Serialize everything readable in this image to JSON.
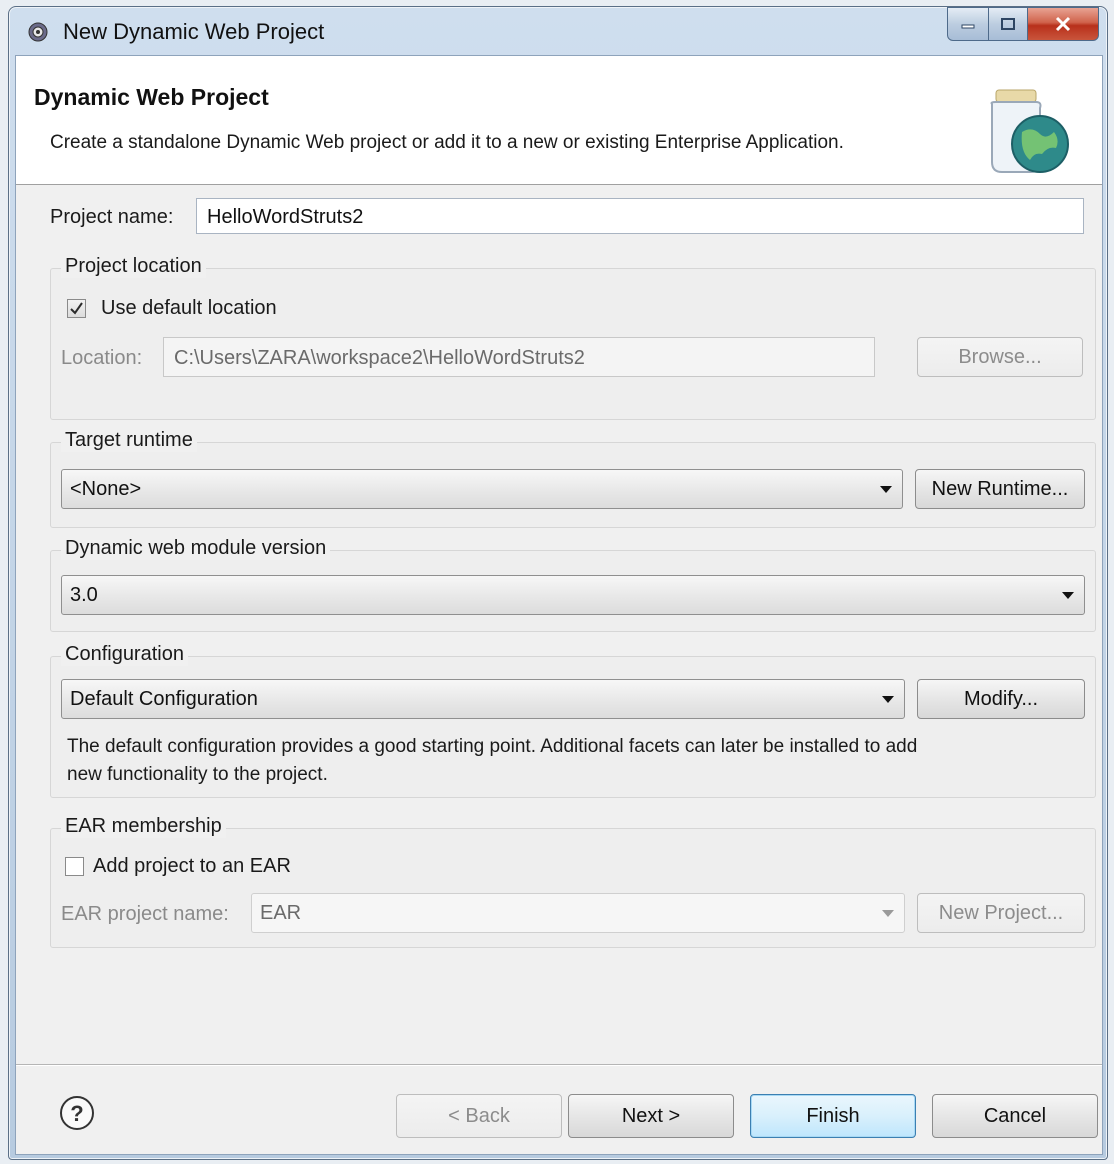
{
  "window": {
    "title": "New Dynamic Web Project"
  },
  "banner": {
    "title": "Dynamic Web Project",
    "description": "Create a standalone Dynamic Web project or add it to a new or existing Enterprise Application."
  },
  "project_name": {
    "label": "Project name:",
    "value": "HelloWordStruts2"
  },
  "project_location": {
    "group_title": "Project location",
    "use_default_label": "Use default location",
    "use_default_checked": true,
    "location_label": "Location:",
    "location_value": "C:\\Users\\ZARA\\workspace2\\HelloWordStruts2",
    "browse_label": "Browse..."
  },
  "target_runtime": {
    "group_title": "Target runtime",
    "selected": "<None>",
    "new_runtime_label": "New Runtime..."
  },
  "module_version": {
    "group_title": "Dynamic web module version",
    "selected": "3.0"
  },
  "configuration": {
    "group_title": "Configuration",
    "selected": "Default Configuration",
    "modify_label": "Modify...",
    "description_line1": "The default configuration provides a good starting point. Additional facets can later be installed to add",
    "description_line2": "new functionality to the project."
  },
  "ear": {
    "group_title": "EAR membership",
    "add_label": "Add project to an EAR",
    "add_checked": false,
    "project_name_label": "EAR project name:",
    "project_name_value": "EAR",
    "new_project_label": "New Project..."
  },
  "footer": {
    "help_glyph": "?",
    "back_label": "< Back",
    "next_label": "Next >",
    "finish_label": "Finish",
    "cancel_label": "Cancel"
  },
  "icons": {
    "app": "eclipse-gear-icon",
    "banner": "web-project-jar-globe-icon",
    "help": "help-circle-icon"
  }
}
